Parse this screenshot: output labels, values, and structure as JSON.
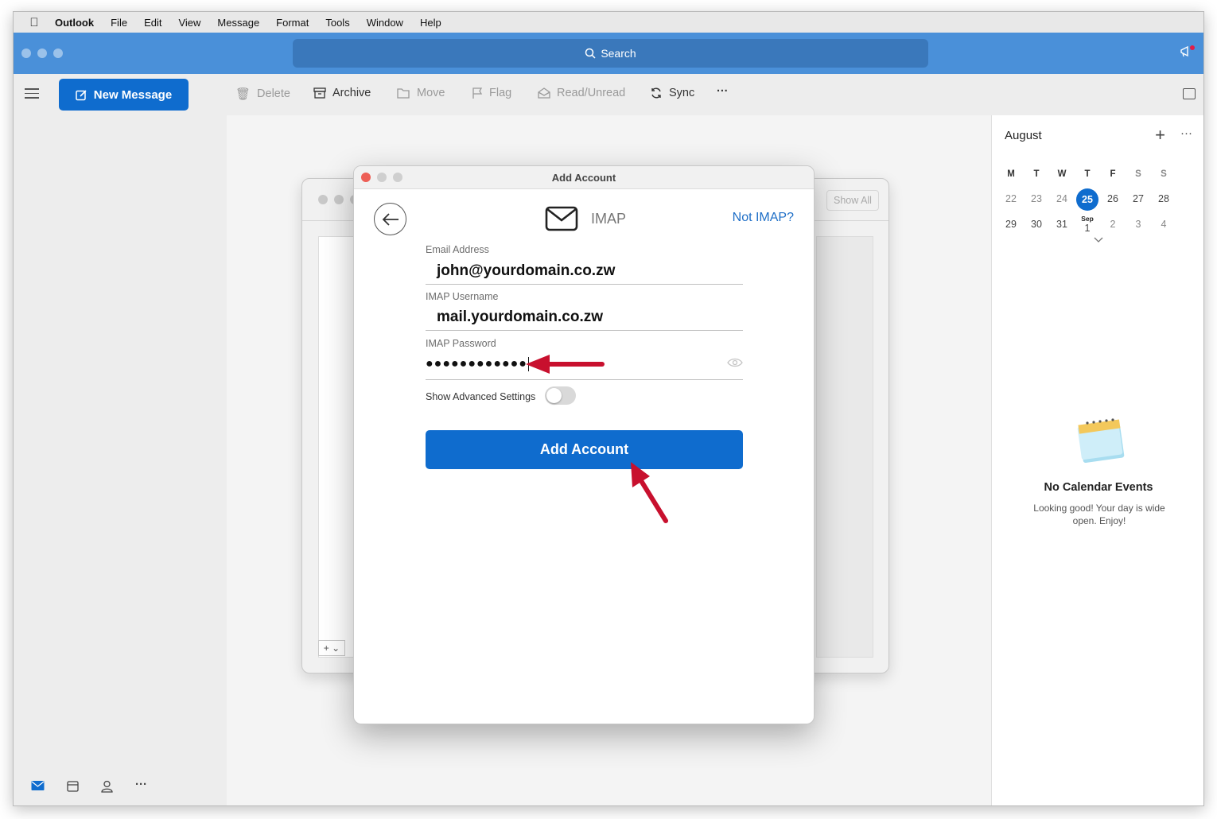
{
  "menubar": {
    "app_name": "Outlook",
    "items": [
      "File",
      "Edit",
      "View",
      "Message",
      "Format",
      "Tools",
      "Window",
      "Help"
    ]
  },
  "search": {
    "label": "Search"
  },
  "toolbar": {
    "new_message": "New Message",
    "delete": "Delete",
    "archive": "Archive",
    "move": "Move",
    "flag": "Flag",
    "read_unread": "Read/Unread",
    "sync": "Sync",
    "more": "···"
  },
  "calendar": {
    "month": "August",
    "add": "+",
    "more": "···",
    "weekdays": [
      "M",
      "T",
      "W",
      "T",
      "F",
      "S",
      "S"
    ],
    "week1": [
      "22",
      "23",
      "24",
      "25",
      "26",
      "27",
      "28"
    ],
    "week2": [
      "29",
      "30",
      "31",
      "1",
      "2",
      "3",
      "4"
    ],
    "sep_label": "Sep",
    "today": "25",
    "empty_title": "No Calendar Events",
    "empty_subtitle": "Looking good! Your day is wide open. Enjoy!"
  },
  "background_window": {
    "show_all": "Show All",
    "add_remove": "+ ⌄"
  },
  "dialog": {
    "title": "Add Account",
    "account_type": "IMAP",
    "not_imap": "Not IMAP?",
    "email_label": "Email Address",
    "email_value": "john@yourdomain.co.zw",
    "username_label": "IMAP Username",
    "username_value": "mail.yourdomain.co.zw",
    "password_label": "IMAP Password",
    "password_value": "●●●●●●●●●●●●",
    "advanced_label": "Show Advanced Settings",
    "advanced_enabled": false,
    "submit_label": "Add Account"
  },
  "colors": {
    "accent": "#0f6cce",
    "titlebar": "#4a90d9",
    "annotation_arrow": "#c8102e"
  }
}
